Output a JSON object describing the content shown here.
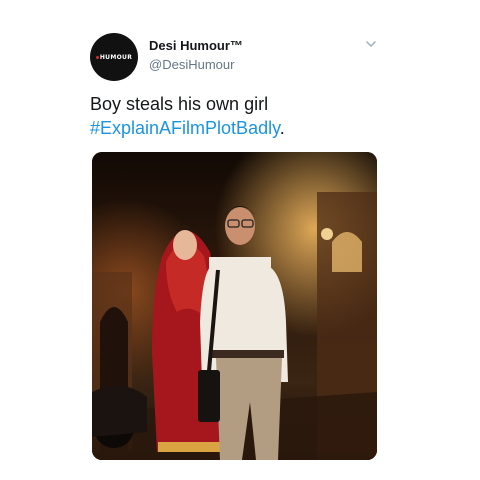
{
  "tweet": {
    "author": {
      "display_name": "Desi Humour™",
      "handle": "@DesiHumour",
      "avatar_text": "HUMOUR"
    },
    "text_line1": "Boy steals his own girl",
    "hashtag": "#ExplainAFilmPlotBadly",
    "text_suffix": ".",
    "colors": {
      "hashtag": "#1b95e0",
      "text": "#14171a",
      "secondary": "#657786"
    },
    "icons": {
      "more": "chevron-down-icon"
    },
    "media": {
      "description_icon": "photo-image"
    }
  }
}
